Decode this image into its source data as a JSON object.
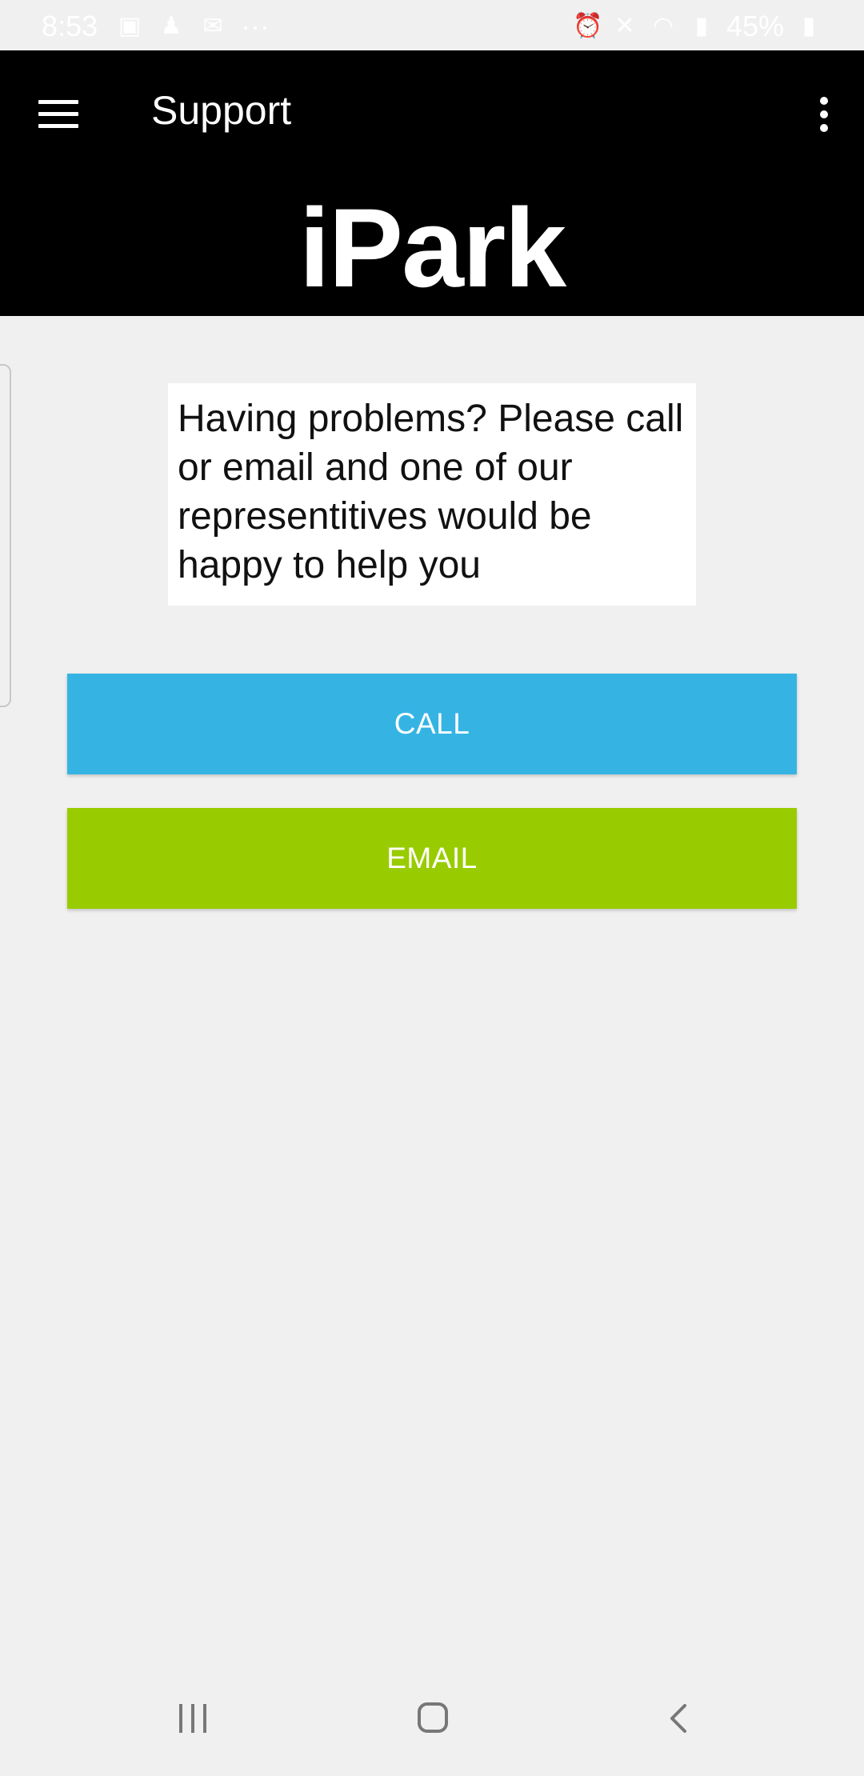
{
  "status_bar": {
    "time": "8:53",
    "battery": "45%",
    "more": "···",
    "left_icons": [
      "gallery-icon",
      "cast-icon",
      "mail-icon"
    ],
    "right_icons": [
      "alarm-icon",
      "mute-icon",
      "wifi-icon",
      "signal-icon",
      "battery-icon"
    ]
  },
  "appbar": {
    "title": "Support",
    "brand": "iPark"
  },
  "message": {
    "text": "Having problems? Please call or email and one of our representitives would be happy to help you"
  },
  "buttons": {
    "call_label": "CALL",
    "email_label": "EMAIL"
  },
  "colors": {
    "appbar": "#000000",
    "call": "#35b4e4",
    "email": "#99cc00",
    "background": "#f0f0f0"
  }
}
